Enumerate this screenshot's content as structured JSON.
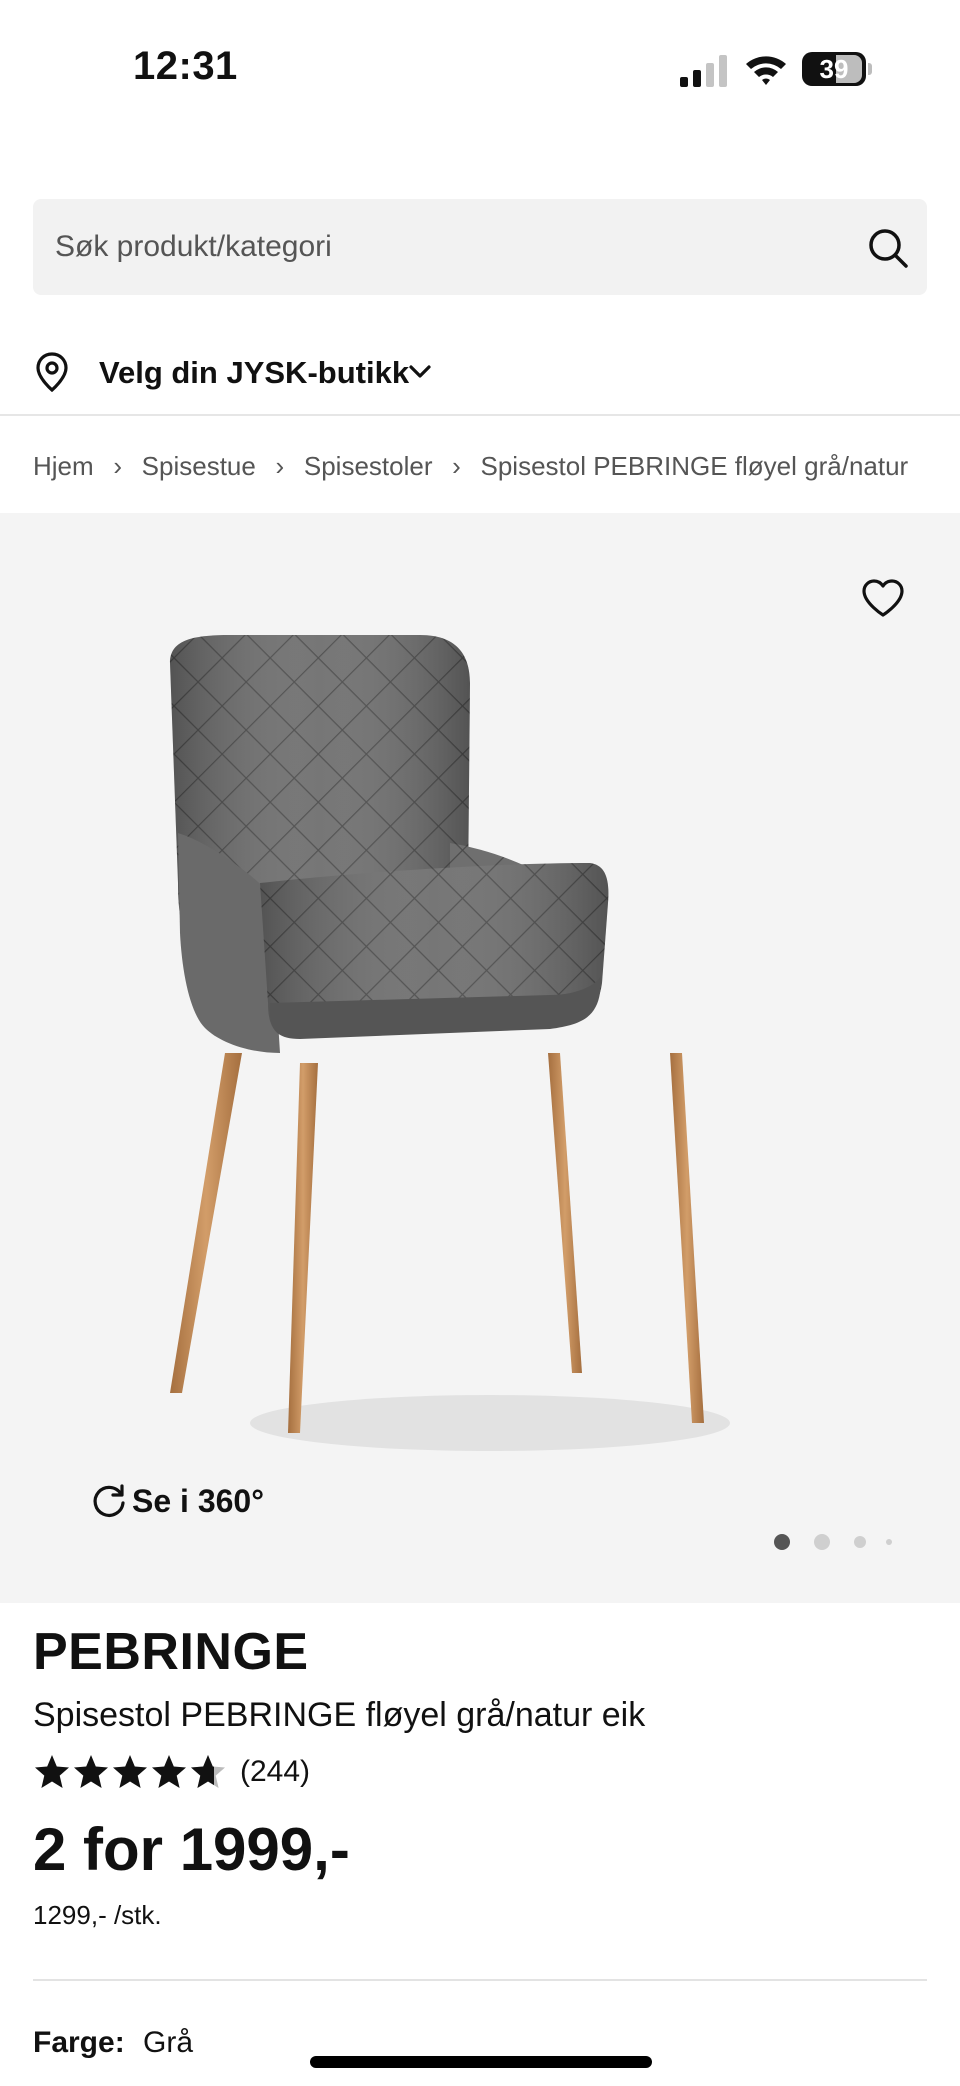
{
  "status_bar": {
    "time": "12:31",
    "battery": "39"
  },
  "search": {
    "placeholder": "Søk produkt/kategori"
  },
  "store": {
    "label": "Velg din JYSK-butikk"
  },
  "breadcrumb": [
    "Hjem",
    "Spisestue",
    "Spisestoler",
    "Spisestol PEBRINGE fløyel grå/natur"
  ],
  "gallery": {
    "view360_label": "Se i 360°",
    "image_count": 4,
    "active_index": 0
  },
  "product": {
    "brand": "PEBRINGE",
    "name": "Spisestol PEBRINGE fløyel grå/natur eik",
    "rating": 4.6,
    "review_count": "(244)",
    "price": "2 for 1999,-",
    "unit_price": "1299,- /stk.",
    "color_label": "Farge:",
    "color_value": "Grå"
  },
  "colors": {
    "upholstery": "#6b6b6b",
    "wood": "#c08a58",
    "background": "#f4f4f4"
  }
}
